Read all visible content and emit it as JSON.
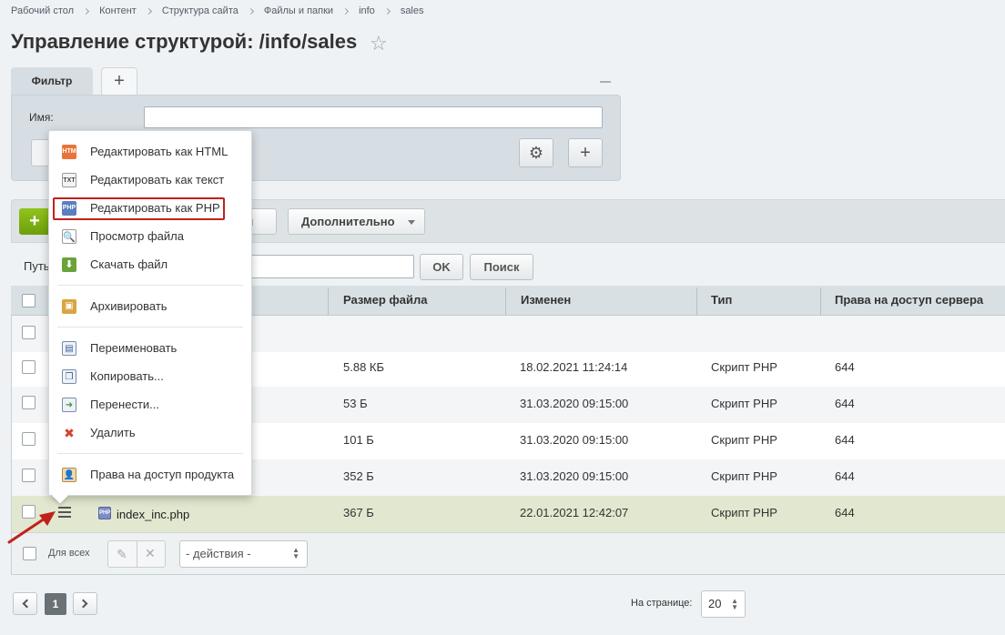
{
  "breadcrumb": [
    "Рабочий стол",
    "Контент",
    "Структура сайта",
    "Файлы и папки",
    "info",
    "sales"
  ],
  "page": {
    "title": "Управление структурой: /info/sales"
  },
  "filter": {
    "tab_label": "Фильтр",
    "add_tab_label": "+",
    "name_label": "Имя:",
    "name_value": "",
    "add_button_label": "+"
  },
  "toolbar": {
    "add_label": "+",
    "partial_button_label": "л",
    "more_label": "Дополнительно"
  },
  "path": {
    "label": "Путь",
    "value": "",
    "ok_label": "OK",
    "search_label": "Поиск"
  },
  "table": {
    "columns": [
      "Размер файла",
      "Изменен",
      "Тип",
      "Права на доступ сервера"
    ],
    "rows": [
      {
        "name": "",
        "size": "",
        "modified": "",
        "type": "",
        "rights": ""
      },
      {
        "name": "",
        "size": "5.88 КБ",
        "modified": "18.02.2021 11:24:14",
        "type": "Скрипт PHP",
        "rights": "644"
      },
      {
        "name": "",
        "size": "53 Б",
        "modified": "31.03.2020 09:15:00",
        "type": "Скрипт PHP",
        "rights": "644"
      },
      {
        "name": "",
        "size": "101 Б",
        "modified": "31.03.2020 09:15:00",
        "type": "Скрипт PHP",
        "rights": "644"
      },
      {
        "name": "",
        "size": "352 Б",
        "modified": "31.03.2020 09:15:00",
        "type": "Скрипт PHP",
        "rights": "644"
      },
      {
        "name": "index_inc.php",
        "size": "367 Б",
        "modified": "22.01.2021 12:42:07",
        "type": "Скрипт PHP",
        "rights": "644"
      }
    ]
  },
  "bulk": {
    "for_all_label": "Для всех",
    "actions_value": "- действия -"
  },
  "pagination": {
    "current_page": "1",
    "per_page_label": "На странице:",
    "per_page_value": "20"
  },
  "context_menu": {
    "items": [
      {
        "label": "Редактировать как HTML",
        "icon": "html-file-icon",
        "badge": "HTM"
      },
      {
        "label": "Редактировать как текст",
        "icon": "text-file-icon",
        "badge": "TXT"
      },
      {
        "label": "Редактировать как PHP",
        "icon": "php-file-icon",
        "badge": "PHP"
      },
      {
        "label": "Просмотр файла",
        "icon": "view-file-icon",
        "badge": ""
      },
      {
        "label": "Скачать файл",
        "icon": "download-icon",
        "badge": ""
      },
      {
        "label": "Архивировать",
        "icon": "archive-icon",
        "badge": ""
      },
      {
        "label": "Переименовать",
        "icon": "rename-icon",
        "badge": ""
      },
      {
        "label": "Копировать...",
        "icon": "copy-icon",
        "badge": ""
      },
      {
        "label": "Перенести...",
        "icon": "move-icon",
        "badge": ""
      },
      {
        "label": "Удалить",
        "icon": "delete-icon",
        "badge": ""
      },
      {
        "label": "Права на доступ продукта",
        "icon": "access-rights-icon",
        "badge": ""
      }
    ],
    "highlighted_item": "Редактировать как PHP"
  },
  "colors": {
    "highlight_border": "#c0211b",
    "add_button": "#7fb015",
    "active_row": "#e2e7cf"
  }
}
